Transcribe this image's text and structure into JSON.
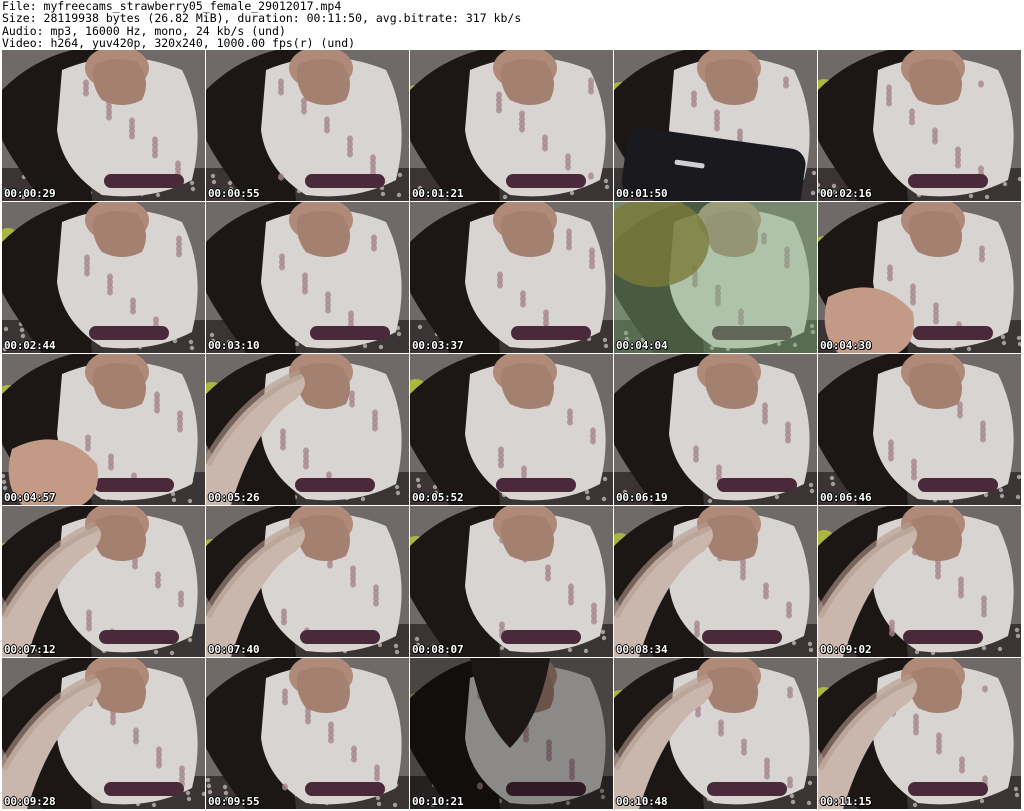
{
  "header": {
    "file_line": "File: myfreecams_strawberry05_female_29012017.mp4",
    "size_line": "Size: 28119938 bytes (26.82 MiB), duration: 00:11:50, avg.bitrate: 317 kb/s",
    "audio_line": "Audio: mp3, 16000 Hz, mono, 24 kb/s (und)",
    "video_line": "Video: h264, yuv420p, 320x240, 1000.00 fps(r) (und)"
  },
  "thumbnails": [
    {
      "timestamp": "00:00:29",
      "variant": "normal"
    },
    {
      "timestamp": "00:00:55",
      "variant": "normal"
    },
    {
      "timestamp": "00:01:21",
      "variant": "normal"
    },
    {
      "timestamp": "00:01:50",
      "variant": "phone"
    },
    {
      "timestamp": "00:02:16",
      "variant": "normal"
    },
    {
      "timestamp": "00:02:44",
      "variant": "normal"
    },
    {
      "timestamp": "00:03:10",
      "variant": "normal"
    },
    {
      "timestamp": "00:03:37",
      "variant": "normal"
    },
    {
      "timestamp": "00:04:04",
      "variant": "green"
    },
    {
      "timestamp": "00:04:30",
      "variant": "hand"
    },
    {
      "timestamp": "00:04:57",
      "variant": "hand"
    },
    {
      "timestamp": "00:05:26",
      "variant": "arm"
    },
    {
      "timestamp": "00:05:52",
      "variant": "normal"
    },
    {
      "timestamp": "00:06:19",
      "variant": "normal"
    },
    {
      "timestamp": "00:06:46",
      "variant": "normal"
    },
    {
      "timestamp": "00:07:12",
      "variant": "arm"
    },
    {
      "timestamp": "00:07:40",
      "variant": "arm"
    },
    {
      "timestamp": "00:08:07",
      "variant": "normal"
    },
    {
      "timestamp": "00:08:34",
      "variant": "arm"
    },
    {
      "timestamp": "00:09:02",
      "variant": "arm"
    },
    {
      "timestamp": "00:09:28",
      "variant": "arm"
    },
    {
      "timestamp": "00:09:55",
      "variant": "normal"
    },
    {
      "timestamp": "00:10:21",
      "variant": "dark"
    },
    {
      "timestamp": "00:10:48",
      "variant": "arm"
    },
    {
      "timestamp": "00:11:15",
      "variant": "arm"
    }
  ],
  "colors": {
    "background": "#ffffff",
    "fabric": "#d8d4d2",
    "skin": "#b08a78",
    "hair": "#1c1614",
    "wall": "#6f6a68",
    "toy": "#4a2a3a",
    "pillow": "#b7c23a",
    "green_tint": "#7fb07a",
    "phone": "#1a1a1e"
  }
}
